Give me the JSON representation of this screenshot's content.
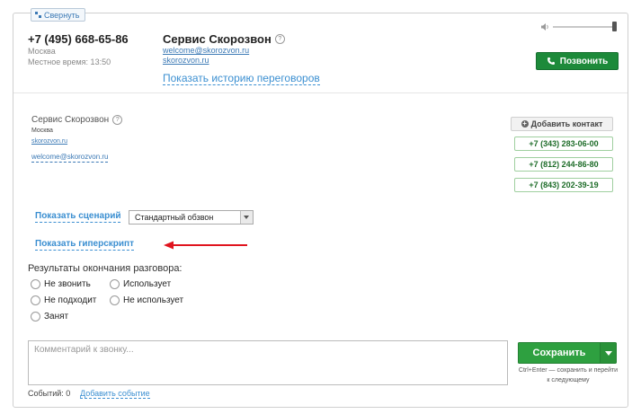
{
  "header": {
    "collapse_label": "Свернуть",
    "phone": "+7 (495) 668-65-86",
    "city": "Москва",
    "local_time": "Местное время: 13:50",
    "company_name": "Сервис Скорозвон",
    "company_email": "welcome@skorozvon.ru",
    "company_site": "skorozvon.ru",
    "history_link": "Показать историю переговоров",
    "call_button": "Позвонить"
  },
  "contact": {
    "name": "Сервис Скорозвон",
    "city": "Москва",
    "site": "skorozvon.ru",
    "email": "welcome@skorozvon.ru",
    "add_contact": "Добавить контакт",
    "phones": [
      "+7 (343) 283-06-00",
      "+7 (812) 244-86-80",
      "+7 (843) 202-39-19"
    ]
  },
  "scenario": {
    "show_link": "Показать сценарий",
    "selected": "Стандартный обзвон",
    "hyperscript_link": "Показать гиперскрипт"
  },
  "results": {
    "label": "Результаты окончания разговора:",
    "options": [
      "Не звонить",
      "Использует",
      "Не подходит",
      "Не использует",
      "Занят"
    ]
  },
  "comment": {
    "placeholder": "Комментарий к звонку..."
  },
  "save": {
    "label": "Сохранить",
    "hint": "Ctrl+Enter — сохранить и перейти к следующему"
  },
  "footer": {
    "events_count": "Событий: 0",
    "add_event": "Добавить событие"
  },
  "colors": {
    "call_green": "#1d8a3a",
    "save_green": "#2ea040",
    "link_blue": "#3b8fd1",
    "annotation_red": "#e0141e"
  }
}
